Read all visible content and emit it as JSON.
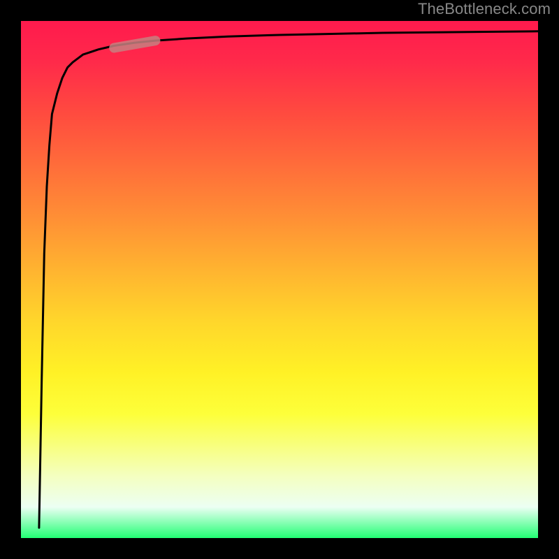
{
  "watermark": "TheBottleneck.com",
  "chart_data": {
    "type": "line",
    "title": "",
    "xlabel": "",
    "ylabel": "",
    "xlim": [
      0,
      100
    ],
    "ylim": [
      0,
      100
    ],
    "legend": false,
    "grid": false,
    "series": [
      {
        "name": "curve",
        "x": [
          3.5,
          4,
          4.5,
          5,
          5.5,
          6,
          7,
          8,
          9,
          10,
          12,
          15,
          18,
          22,
          26,
          32,
          40,
          50,
          60,
          70,
          80,
          90,
          100
        ],
        "y": [
          2,
          30,
          55,
          68,
          76,
          82,
          86,
          89,
          91,
          92,
          93.5,
          94.5,
          95.2,
          95.8,
          96.2,
          96.6,
          97,
          97.3,
          97.5,
          97.7,
          97.8,
          97.9,
          98
        ]
      }
    ],
    "annotations": [
      {
        "name": "marker",
        "x_range": [
          18,
          26
        ],
        "y_range": [
          94.8,
          96.2
        ],
        "style": "pill"
      }
    ],
    "background": "rainbow-vertical-gradient"
  }
}
